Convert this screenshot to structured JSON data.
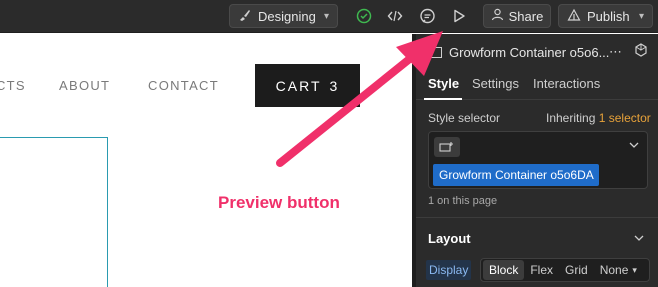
{
  "toolbar": {
    "mode_label": "Designing",
    "share_label": "Share",
    "publish_label": "Publish",
    "icons": [
      "brush-icon",
      "check-circle-icon",
      "code-icon",
      "comment-icon",
      "play-preview-icon",
      "person-icon",
      "publish-icon"
    ],
    "check_color": "#3fb950"
  },
  "canvas": {
    "nav_links": [
      "ECTS",
      "ABOUT",
      "CONTACT"
    ],
    "cart_label": "CART",
    "cart_count": "3",
    "selection_color": "#2a9bb0"
  },
  "panel": {
    "element_name": "Growform Container o5o6...",
    "tabs": [
      "Style",
      "Settings",
      "Interactions"
    ],
    "style_selector_label": "Style selector",
    "inheriting_prefix": "Inheriting",
    "inheriting_count": "1 selector",
    "class_name": "Growform Container o5o6DA",
    "on_page": "1 on this page",
    "layout_title": "Layout",
    "display_label": "Display",
    "display_options": [
      "Block",
      "Flex",
      "Grid",
      "None"
    ],
    "display_selected": "Block",
    "accent_color": "#e7a23a",
    "class_color": "#1f6cc9"
  },
  "annotation": {
    "label": "Preview button",
    "color": "#f0306a"
  }
}
